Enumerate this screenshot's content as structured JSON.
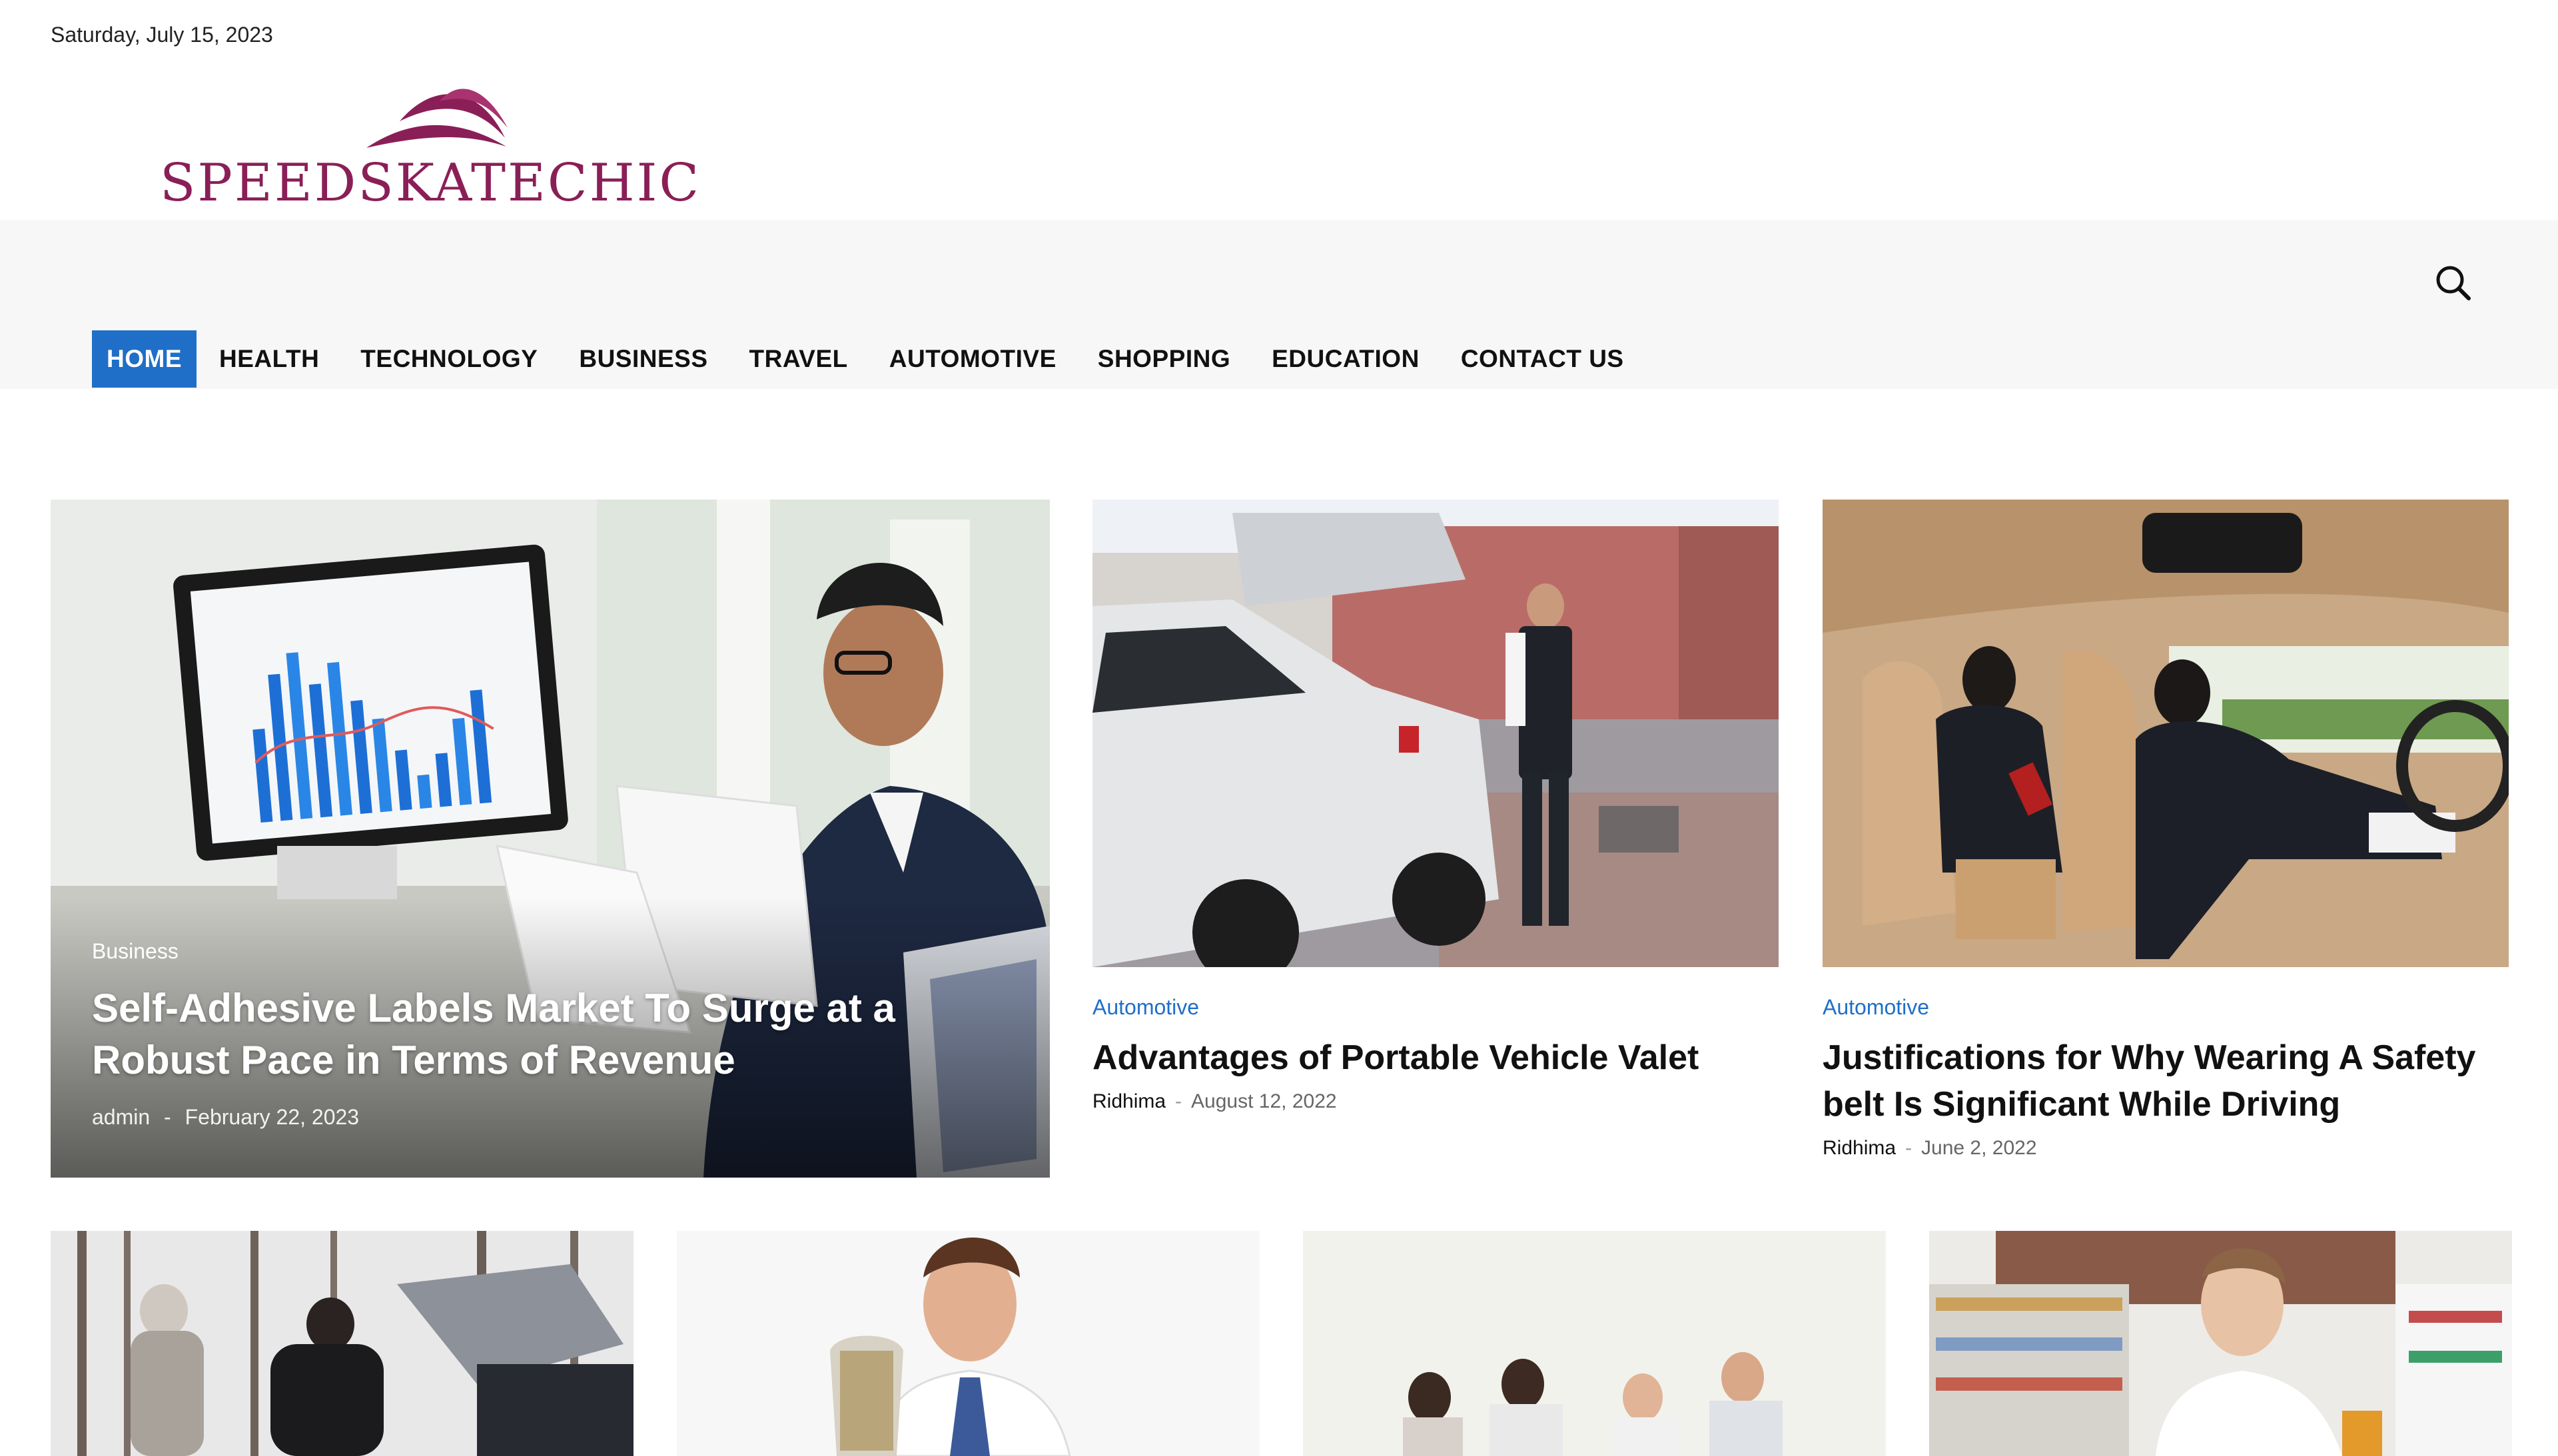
{
  "header": {
    "date": "Saturday, July 15, 2023",
    "logo_text": "SPEEDSKATECHIC"
  },
  "nav": {
    "items": [
      "HOME",
      "HEALTH",
      "TECHNOLOGY",
      "BUSINESS",
      "TRAVEL",
      "AUTOMOTIVE",
      "SHOPPING",
      "EDUCATION",
      "CONTACT US"
    ],
    "active": "HOME"
  },
  "hero": {
    "category": "Business",
    "title": "Self-Adhesive Labels Market To Surge at a Robust Pace in Terms of Revenue",
    "author": "admin",
    "date": "February 22, 2023"
  },
  "cards": [
    {
      "category": "Automotive",
      "title": "Advantages of Portable Vehicle Valet",
      "author": "Ridhima",
      "date": "August 12, 2022"
    },
    {
      "category": "Automotive",
      "title": "Justifications for Why Wearing A Safety belt Is Significant While Driving",
      "author": "Ridhima",
      "date": "June 2, 2022"
    }
  ],
  "colors": {
    "accent": "#1f6fc8",
    "logo": "#8a1f57",
    "menubar_bg": "#f7f7f7"
  },
  "icons": {
    "search": "search-icon"
  }
}
